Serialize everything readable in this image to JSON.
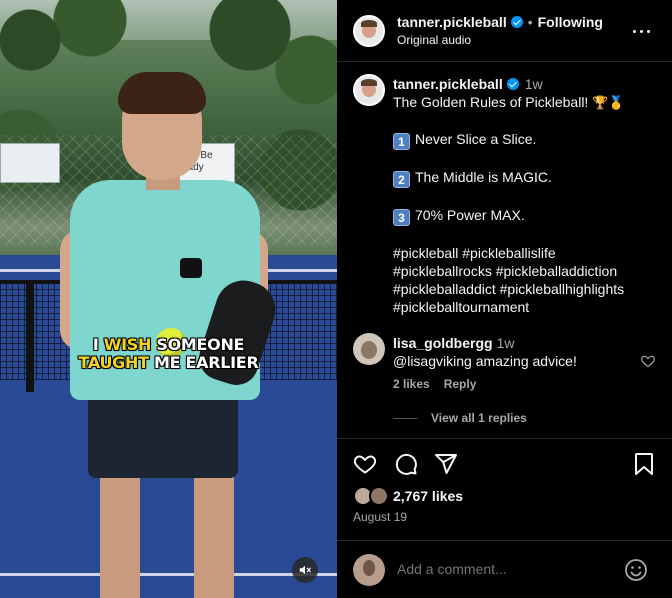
{
  "video": {
    "caption_part1": "I ",
    "caption_hl1": "WISH",
    "caption_part2": " SOMEONE",
    "caption_hl2": "TAUGHT",
    "caption_part3": " ME EARLIER",
    "banner_text": "ays Be\neady"
  },
  "header": {
    "username": "tanner.pickleball",
    "separator": "•",
    "follow_status": "Following",
    "audio": "Original audio"
  },
  "post": {
    "username": "tanner.pickleball",
    "time": "1w",
    "title": "The Golden Rules of Pickleball!",
    "rules": [
      {
        "num": "1",
        "text": "Never Slice a Slice."
      },
      {
        "num": "2",
        "text": "The Middle is MAGIC."
      },
      {
        "num": "3",
        "text": "70% Power MAX."
      }
    ],
    "hashtags": [
      "#pickleball #pickleballislife",
      "#pickleballrocks #pickleballaddiction",
      "#pickleballaddict #pickleballhighlights",
      "#pickleballtournament"
    ]
  },
  "comment": {
    "username": "lisa_goldbergg",
    "time": "1w",
    "text": "@lisagviking amazing advice!",
    "likes": "2 likes",
    "reply_label": "Reply",
    "view_replies": "View all 1 replies"
  },
  "stats": {
    "likes": "2,767 likes",
    "date": "August 19"
  },
  "composer": {
    "placeholder": "Add a comment..."
  },
  "colors": {
    "verified": "#0095f6",
    "caption_highlight": "#f4d21f",
    "muted_text": "#a8a8a8"
  },
  "icons": {
    "trophy": "🏆",
    "medal": "🥇"
  }
}
